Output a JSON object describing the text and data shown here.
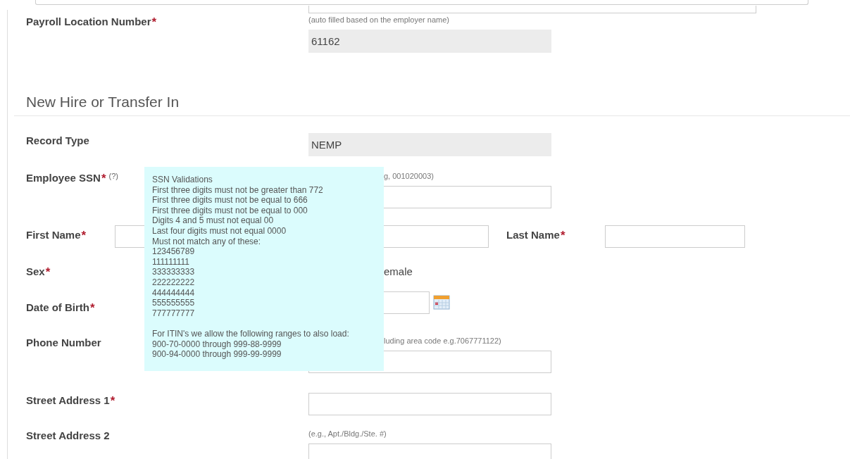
{
  "required_mark": "*",
  "payroll": {
    "label": "Payroll Location Number",
    "required": true,
    "hint": "(auto filled based on the employer name)",
    "value": "61162"
  },
  "section": {
    "title": "New Hire or Transfer In"
  },
  "fields": [
    {
      "kind": "readonly",
      "label": "Record Type",
      "required": false,
      "value": "NEMP"
    },
    {
      "kind": "ssn",
      "label": "Employee SSN",
      "required": true,
      "help": "(?)",
      "hint": "g, 001020003)"
    },
    {
      "kind": "pair",
      "label": "First Name",
      "required": true,
      "label_2": "Last Name",
      "required_2": true
    },
    {
      "kind": "radio",
      "label": "Sex",
      "required": true,
      "option": "emale"
    },
    {
      "kind": "date",
      "label": "Date of Birth",
      "required": true
    },
    {
      "kind": "text",
      "label": "Phone Number",
      "required": false,
      "hint": "luding area code e.g.7067771122)",
      "hint_offset": true
    },
    {
      "kind": "text",
      "label": "Street Address 1",
      "required": true
    },
    {
      "kind": "text",
      "label": "Street Address 2",
      "required": false,
      "hint": "(e.g., Apt./Bldg./Ste. #)",
      "hint_offset": false
    }
  ],
  "tooltip": {
    "groups": [
      [
        "SSN Validations",
        "First three digits must not be greater than 772",
        "First three digits must not be equal to 666",
        "First three digits must not be equal to 000",
        "Digits 4 and 5 must not equal 00",
        "Last four digits must not equal 0000",
        "Must not match any of these:",
        "123456789",
        "111111111",
        "333333333",
        "222222222",
        "444444444",
        "555555555",
        "777777777"
      ],
      [
        "For ITIN's we allow the following ranges to also load:",
        "900-70-0000 through 999-88-9999",
        "900-94-0000 through 999-99-9999"
      ]
    ]
  }
}
